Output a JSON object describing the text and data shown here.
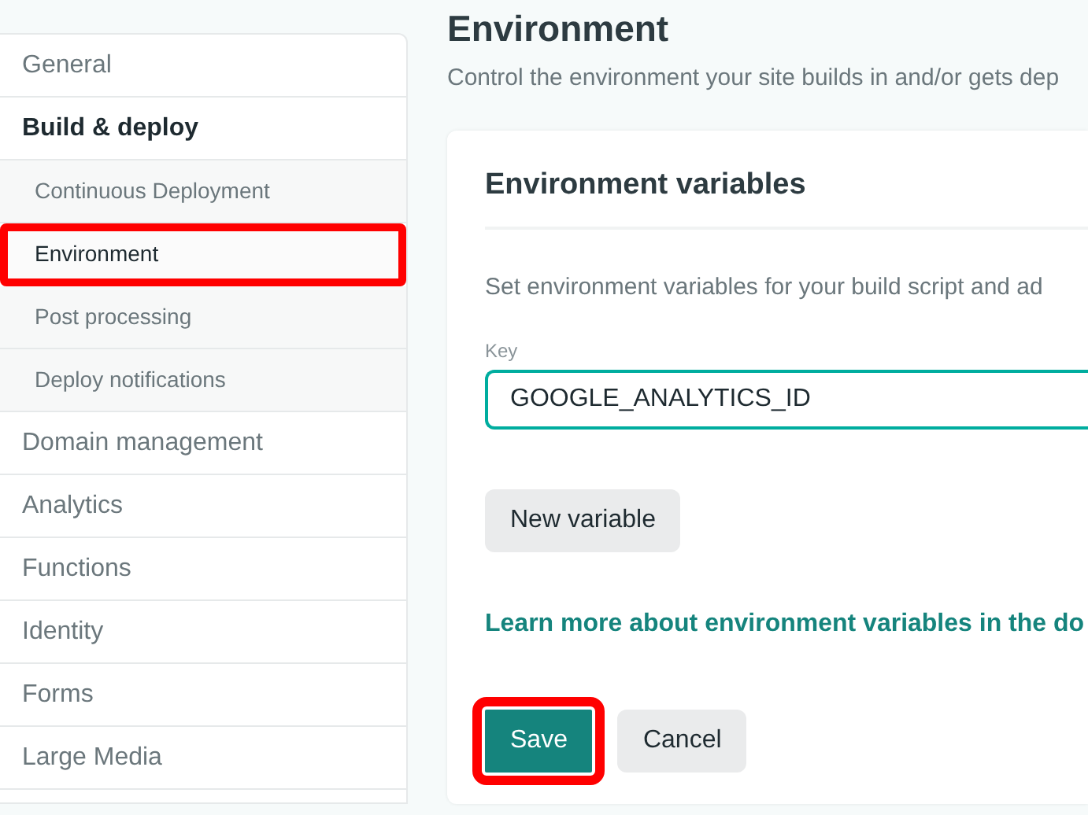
{
  "sidebar": {
    "items": [
      {
        "label": "General",
        "selected": false,
        "expanded": false
      },
      {
        "label": "Build & deploy",
        "selected": false,
        "expanded": true,
        "children": [
          {
            "label": "Continuous Deployment",
            "selected": false,
            "highlighted": false
          },
          {
            "label": "Environment",
            "selected": true,
            "highlighted": true
          },
          {
            "label": "Post processing",
            "selected": false,
            "highlighted": false
          },
          {
            "label": "Deploy notifications",
            "selected": false,
            "highlighted": false
          }
        ]
      },
      {
        "label": "Domain management",
        "selected": false,
        "expanded": false
      },
      {
        "label": "Analytics",
        "selected": false,
        "expanded": false
      },
      {
        "label": "Functions",
        "selected": false,
        "expanded": false
      },
      {
        "label": "Identity",
        "selected": false,
        "expanded": false
      },
      {
        "label": "Forms",
        "selected": false,
        "expanded": false
      },
      {
        "label": "Large Media",
        "selected": false,
        "expanded": false
      }
    ]
  },
  "page": {
    "title": "Environment",
    "subtitle": "Control the environment your site builds in and/or gets dep"
  },
  "card": {
    "title": "Environment variables",
    "description": "Set environment variables for your build script and ad",
    "key_field": {
      "label": "Key",
      "value": "GOOGLE_ANALYTICS_ID"
    },
    "new_variable_button": "New variable",
    "docs_link": "Learn more about environment variables in the do",
    "buttons": [
      {
        "label": "Save",
        "kind": "primary",
        "highlighted": true
      },
      {
        "label": "Cancel",
        "kind": "secondary",
        "highlighted": false
      }
    ]
  }
}
